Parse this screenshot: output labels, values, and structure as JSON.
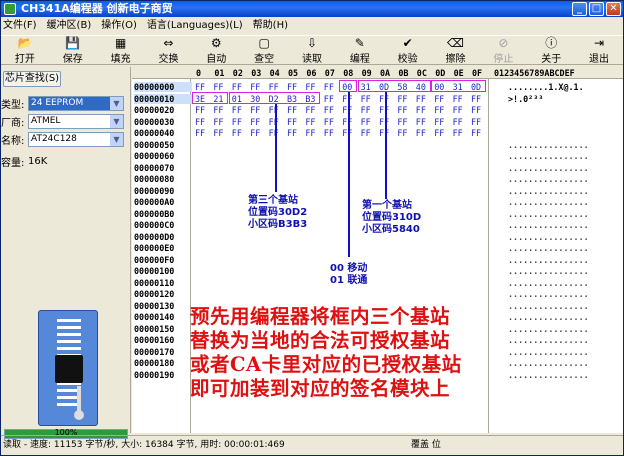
{
  "window": {
    "title": "CH341A编程器 创新电子商贸",
    "minimize": "_",
    "maximize": "□",
    "close": "✕"
  },
  "menu": [
    "文件(F)",
    "缓冲区(B)",
    "操作(O)",
    "语言(Languages)(L)",
    "帮助(H)"
  ],
  "toolbar": [
    {
      "label": "打开",
      "icon": "folder-icon",
      "glyph": "📂",
      "enabled": true
    },
    {
      "label": "保存",
      "icon": "floppy-icon",
      "glyph": "💾",
      "enabled": true
    },
    {
      "label": "填充",
      "icon": "fill-icon",
      "glyph": "▦",
      "enabled": true
    },
    {
      "label": "交换",
      "icon": "swap-icon",
      "glyph": "⇔",
      "enabled": true
    },
    {
      "label": "自动",
      "icon": "auto-icon",
      "glyph": "⚙",
      "enabled": true
    },
    {
      "label": "查空",
      "icon": "blank-check-icon",
      "glyph": "▢",
      "enabled": true
    },
    {
      "label": "读取",
      "icon": "read-icon",
      "glyph": "⇩",
      "enabled": true
    },
    {
      "label": "编程",
      "icon": "program-icon",
      "glyph": "✎",
      "enabled": true
    },
    {
      "label": "校验",
      "icon": "verify-icon",
      "glyph": "✔",
      "enabled": true
    },
    {
      "label": "擦除",
      "icon": "erase-icon",
      "glyph": "⌫",
      "enabled": true
    },
    {
      "label": "停止",
      "icon": "stop-icon",
      "glyph": "⊘",
      "enabled": false
    },
    {
      "label": "关于",
      "icon": "info-icon",
      "glyph": "ⓘ",
      "enabled": true
    },
    {
      "label": "退出",
      "icon": "exit-icon",
      "glyph": "⇥",
      "enabled": true
    }
  ],
  "left": {
    "chip_search": "芯片查找(S)",
    "type_label": "类型:",
    "type_value": "24 EEPROM",
    "maker_label": "厂商:",
    "maker_value": "ATMEL",
    "name_label": "名称:",
    "name_value": "AT24C128",
    "capacity_label": "容量:",
    "capacity_value": "16K",
    "progress_pct": 100,
    "progress_text": "100%"
  },
  "hex": {
    "header": [
      "0",
      "1",
      "2",
      "3",
      "4",
      "5",
      "6",
      "7",
      "8",
      "9",
      "A",
      "B",
      "C",
      "D",
      "E",
      "F"
    ],
    "header_labels": [
      "0",
      "01",
      "02",
      "03",
      "04",
      "05",
      "06",
      "07",
      "08",
      "09",
      "0A",
      "0B",
      "0C",
      "0D",
      "0E",
      "0F"
    ],
    "ascii_header": "0123456789ABCDEF",
    "addresses": [
      "00000000",
      "00000010",
      "00000020",
      "00000030",
      "00000040",
      "00000050",
      "00000060",
      "00000070",
      "00000080",
      "00000090",
      "000000A0",
      "000000B0",
      "000000C0",
      "000000D0",
      "000000E0",
      "000000F0",
      "00000100",
      "00000110",
      "00000120",
      "00000130",
      "00000140",
      "00000150",
      "00000160",
      "00000170",
      "00000180",
      "00000190"
    ],
    "rows": [
      [
        "FF",
        "FF",
        "FF",
        "FF",
        "FF",
        "FF",
        "FF",
        "FF",
        "00",
        "31",
        "0D",
        "58",
        "40",
        "00",
        "31",
        "0D"
      ],
      [
        "3E",
        "21",
        "01",
        "30",
        "D2",
        "B3",
        "B3",
        "FF",
        "FF",
        "FF",
        "FF",
        "FF",
        "FF",
        "FF",
        "FF",
        "FF"
      ],
      [
        "FF",
        "FF",
        "FF",
        "FF",
        "FF",
        "FF",
        "FF",
        "FF",
        "FF",
        "FF",
        "FF",
        "FF",
        "FF",
        "FF",
        "FF",
        "FF"
      ],
      [
        "FF",
        "FF",
        "FF",
        "FF",
        "FF",
        "FF",
        "FF",
        "FF",
        "FF",
        "FF",
        "FF",
        "FF",
        "FF",
        "FF",
        "FF",
        "FF"
      ],
      [
        "FF",
        "FF",
        "FF",
        "FF",
        "FF",
        "FF",
        "FF",
        "FF",
        "FF",
        "FF",
        "FF",
        "FF",
        "FF",
        "FF",
        "FF",
        "FF"
      ]
    ],
    "ascii_rows": [
      "........1.X@.1.",
      ">!.0²³³",
      "",
      "",
      ""
    ]
  },
  "annotations": {
    "third_station": [
      "第三个基站",
      "位置码30D2",
      "小区码B3B3"
    ],
    "first_station": [
      "第一个基站",
      "位置码310D",
      "小区码5840"
    ],
    "operator": [
      "00 移动",
      "01 联通"
    ],
    "instruction": [
      "预先用编程器将框内三个基站",
      "替换为当地的合法可授权基站",
      "或者CA卡里对应的已授权基站",
      "即可加装到对应的签名模块上"
    ]
  },
  "status": {
    "left": "读取 - 速度: 11153 字节/秒, 大小: 16384 字节, 用时: 00:00:01:469",
    "right": "覆盖  位"
  }
}
